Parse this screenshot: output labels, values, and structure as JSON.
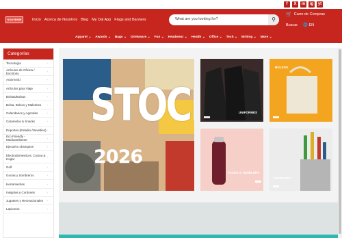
{
  "social": [
    "f",
    "X",
    "in",
    "ig",
    "yt"
  ],
  "header": {
    "logo": "SOUVENIR",
    "nav": [
      "Inicio",
      "Acerca de Nosotros",
      "Blog",
      "My Dal App",
      "Flags and Banners"
    ],
    "search_placeholder": "What are you looking for?",
    "search_icon": "search-icon",
    "cart_label": "Carro de Compras",
    "buscar_label": "Buscar",
    "lang_label": "EN"
  },
  "categories_nav": [
    "Apparel",
    "Awards",
    "Bags",
    "Drinkware",
    "Fun",
    "Headwear",
    "Health",
    "Office",
    "Tech",
    "Writing",
    "More"
  ],
  "sidebar": {
    "title": "Categorías",
    "items": [
      "Tecnología",
      "Artículos de Oficina / Escritorio",
      "Automotriz",
      "Artículos para Viaje",
      "Bolsas/Bolsas",
      "Bolsa, Bolsos y Maletines",
      "Calendarios y Agendas",
      "Caramelos & Snacks",
      "Deportes (Estadio /Novelties)",
      "Eco Friendly - Medioambiente",
      "Ejecutivo obsequios",
      "Electrodomesticos, Cocina & Hogar",
      "Golf",
      "Gorras y Sombreros",
      "Herramientas",
      "Insignias y Cordones",
      "Juguetes y Recreacionales",
      "Lapiceros"
    ]
  },
  "hero": {
    "title": "STOCK",
    "year": "2026"
  },
  "tiles": [
    {
      "label": "UNIFORMES",
      "bg": "#2b2b2b"
    },
    {
      "label": "BOLSOS",
      "bg": "#f4a51f"
    },
    {
      "label": "VASOS & TUMBLERS",
      "bg": "#f6cfc8"
    },
    {
      "label": "ESCRITURA",
      "bg": "#e9e9e9"
    }
  ],
  "colors": {
    "brand": "#c6261d",
    "accent_teal": "#2fb8b0"
  }
}
